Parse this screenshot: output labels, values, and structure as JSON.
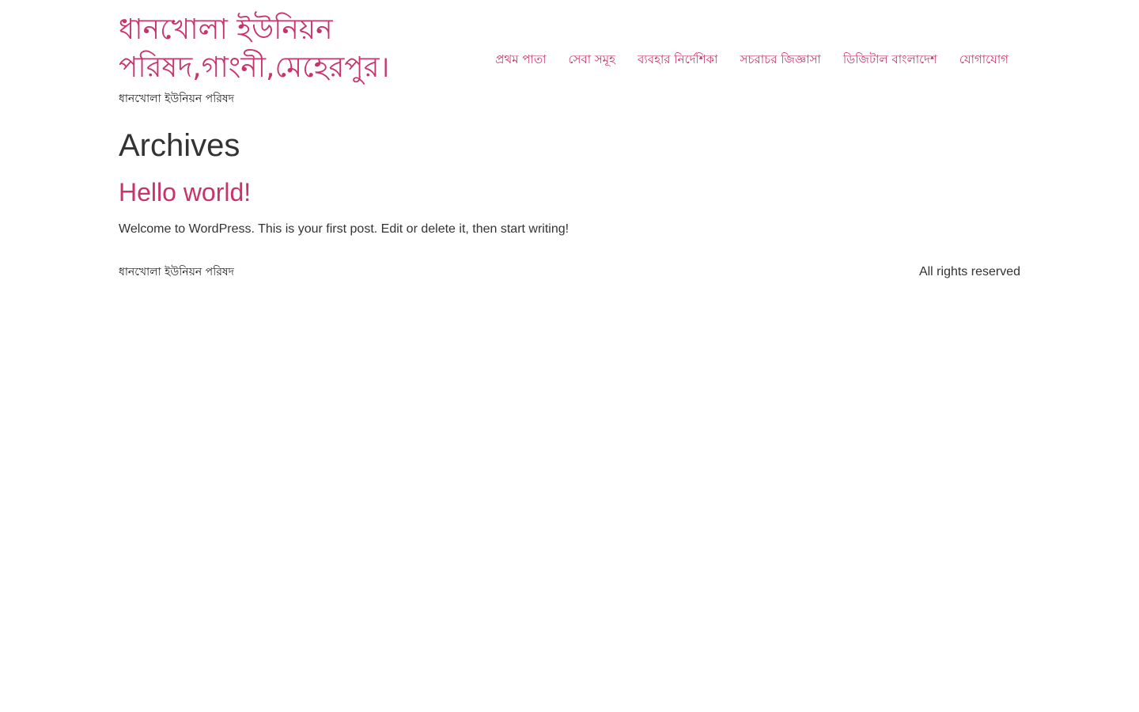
{
  "header": {
    "site_title": "ধানখোলা ইউনিয়ন পরিষদ,গাংনী,মেহেরপুর।",
    "site_description": "ধানখোলা ইউনিয়ন পরিষদ"
  },
  "nav": {
    "items": [
      {
        "label": "প্রথম পাতা"
      },
      {
        "label": "সেবা সমূহ"
      },
      {
        "label": "ব্যবহার নির্দেশিকা"
      },
      {
        "label": "সচরাচর জিজ্ঞাসা"
      },
      {
        "label": "ডিজিটাল বাংলাদেশ"
      },
      {
        "label": "যোগাযোগ"
      }
    ]
  },
  "main": {
    "archive_title": "Archives",
    "post": {
      "title": "Hello world!",
      "excerpt": "Welcome to WordPress. This is your first post. Edit or delete it, then start writing!"
    }
  },
  "footer": {
    "left_text": "ধানখোলা ইউনিয়ন পরিষদ",
    "right_text": "All rights reserved"
  },
  "colors": {
    "accent": "#c7336a",
    "text": "#333333",
    "background": "#ffffff"
  }
}
